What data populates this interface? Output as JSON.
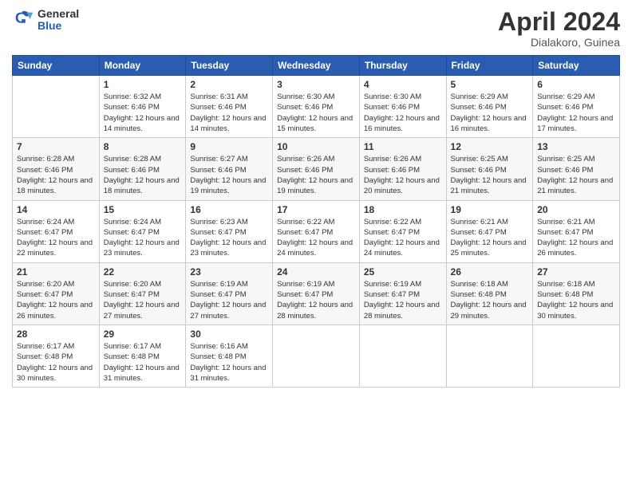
{
  "logo": {
    "general": "General",
    "blue": "Blue"
  },
  "title": {
    "month_year": "April 2024",
    "location": "Dialakoro, Guinea"
  },
  "headers": [
    "Sunday",
    "Monday",
    "Tuesday",
    "Wednesday",
    "Thursday",
    "Friday",
    "Saturday"
  ],
  "weeks": [
    [
      {
        "day": "",
        "info": ""
      },
      {
        "day": "1",
        "info": "Sunrise: 6:32 AM\nSunset: 6:46 PM\nDaylight: 12 hours\nand 14 minutes."
      },
      {
        "day": "2",
        "info": "Sunrise: 6:31 AM\nSunset: 6:46 PM\nDaylight: 12 hours\nand 14 minutes."
      },
      {
        "day": "3",
        "info": "Sunrise: 6:30 AM\nSunset: 6:46 PM\nDaylight: 12 hours\nand 15 minutes."
      },
      {
        "day": "4",
        "info": "Sunrise: 6:30 AM\nSunset: 6:46 PM\nDaylight: 12 hours\nand 16 minutes."
      },
      {
        "day": "5",
        "info": "Sunrise: 6:29 AM\nSunset: 6:46 PM\nDaylight: 12 hours\nand 16 minutes."
      },
      {
        "day": "6",
        "info": "Sunrise: 6:29 AM\nSunset: 6:46 PM\nDaylight: 12 hours\nand 17 minutes."
      }
    ],
    [
      {
        "day": "7",
        "info": "Sunrise: 6:28 AM\nSunset: 6:46 PM\nDaylight: 12 hours\nand 18 minutes."
      },
      {
        "day": "8",
        "info": "Sunrise: 6:28 AM\nSunset: 6:46 PM\nDaylight: 12 hours\nand 18 minutes."
      },
      {
        "day": "9",
        "info": "Sunrise: 6:27 AM\nSunset: 6:46 PM\nDaylight: 12 hours\nand 19 minutes."
      },
      {
        "day": "10",
        "info": "Sunrise: 6:26 AM\nSunset: 6:46 PM\nDaylight: 12 hours\nand 19 minutes."
      },
      {
        "day": "11",
        "info": "Sunrise: 6:26 AM\nSunset: 6:46 PM\nDaylight: 12 hours\nand 20 minutes."
      },
      {
        "day": "12",
        "info": "Sunrise: 6:25 AM\nSunset: 6:46 PM\nDaylight: 12 hours\nand 21 minutes."
      },
      {
        "day": "13",
        "info": "Sunrise: 6:25 AM\nSunset: 6:46 PM\nDaylight: 12 hours\nand 21 minutes."
      }
    ],
    [
      {
        "day": "14",
        "info": "Sunrise: 6:24 AM\nSunset: 6:47 PM\nDaylight: 12 hours\nand 22 minutes."
      },
      {
        "day": "15",
        "info": "Sunrise: 6:24 AM\nSunset: 6:47 PM\nDaylight: 12 hours\nand 23 minutes."
      },
      {
        "day": "16",
        "info": "Sunrise: 6:23 AM\nSunset: 6:47 PM\nDaylight: 12 hours\nand 23 minutes."
      },
      {
        "day": "17",
        "info": "Sunrise: 6:22 AM\nSunset: 6:47 PM\nDaylight: 12 hours\nand 24 minutes."
      },
      {
        "day": "18",
        "info": "Sunrise: 6:22 AM\nSunset: 6:47 PM\nDaylight: 12 hours\nand 24 minutes."
      },
      {
        "day": "19",
        "info": "Sunrise: 6:21 AM\nSunset: 6:47 PM\nDaylight: 12 hours\nand 25 minutes."
      },
      {
        "day": "20",
        "info": "Sunrise: 6:21 AM\nSunset: 6:47 PM\nDaylight: 12 hours\nand 26 minutes."
      }
    ],
    [
      {
        "day": "21",
        "info": "Sunrise: 6:20 AM\nSunset: 6:47 PM\nDaylight: 12 hours\nand 26 minutes."
      },
      {
        "day": "22",
        "info": "Sunrise: 6:20 AM\nSunset: 6:47 PM\nDaylight: 12 hours\nand 27 minutes."
      },
      {
        "day": "23",
        "info": "Sunrise: 6:19 AM\nSunset: 6:47 PM\nDaylight: 12 hours\nand 27 minutes."
      },
      {
        "day": "24",
        "info": "Sunrise: 6:19 AM\nSunset: 6:47 PM\nDaylight: 12 hours\nand 28 minutes."
      },
      {
        "day": "25",
        "info": "Sunrise: 6:19 AM\nSunset: 6:47 PM\nDaylight: 12 hours\nand 28 minutes."
      },
      {
        "day": "26",
        "info": "Sunrise: 6:18 AM\nSunset: 6:48 PM\nDaylight: 12 hours\nand 29 minutes."
      },
      {
        "day": "27",
        "info": "Sunrise: 6:18 AM\nSunset: 6:48 PM\nDaylight: 12 hours\nand 30 minutes."
      }
    ],
    [
      {
        "day": "28",
        "info": "Sunrise: 6:17 AM\nSunset: 6:48 PM\nDaylight: 12 hours\nand 30 minutes."
      },
      {
        "day": "29",
        "info": "Sunrise: 6:17 AM\nSunset: 6:48 PM\nDaylight: 12 hours\nand 31 minutes."
      },
      {
        "day": "30",
        "info": "Sunrise: 6:16 AM\nSunset: 6:48 PM\nDaylight: 12 hours\nand 31 minutes."
      },
      {
        "day": "",
        "info": ""
      },
      {
        "day": "",
        "info": ""
      },
      {
        "day": "",
        "info": ""
      },
      {
        "day": "",
        "info": ""
      }
    ]
  ]
}
